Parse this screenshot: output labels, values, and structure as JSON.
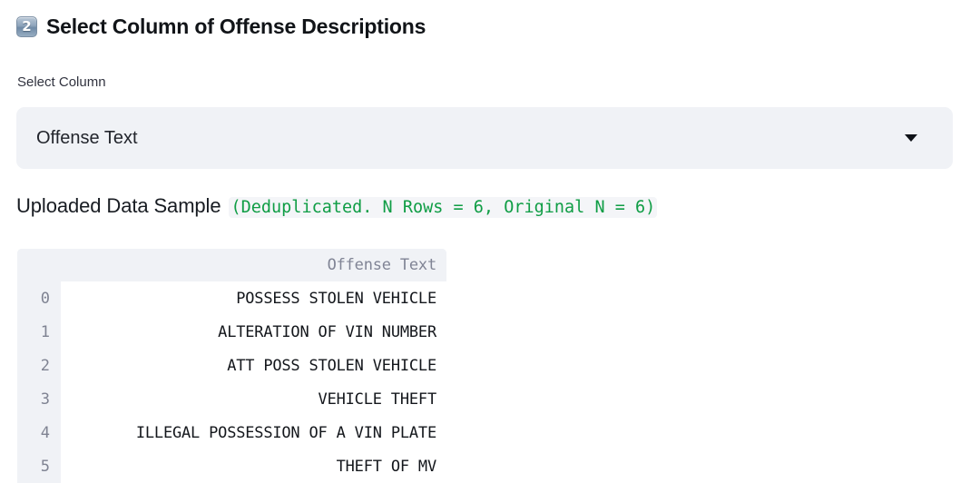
{
  "section": {
    "badge": "2",
    "badge_icon": "keycap-two-icon",
    "title": "Select Column of Offense Descriptions"
  },
  "select_column": {
    "label": "Select Column",
    "selected_value": "Offense Text",
    "caret_icon": "chevron-down-icon"
  },
  "data_sample": {
    "heading": "Uploaded Data Sample",
    "summary": "(Deduplicated. N Rows = 6, Original N = 6)"
  },
  "table": {
    "column_header": "Offense Text",
    "index_header": "",
    "rows": [
      {
        "index": "0",
        "value": "POSSESS STOLEN VEHICLE"
      },
      {
        "index": "1",
        "value": "ALTERATION OF VIN NUMBER"
      },
      {
        "index": "2",
        "value": "ATT POSS STOLEN VEHICLE"
      },
      {
        "index": "3",
        "value": "VEHICLE THEFT"
      },
      {
        "index": "4",
        "value": "ILLEGAL POSSESSION OF A VIN PLATE"
      },
      {
        "index": "5",
        "value": "THEFT OF MV"
      }
    ]
  },
  "colors": {
    "surface_gray": "#f0f2f6",
    "text_primary": "#0e1117",
    "text_muted": "#808495",
    "accent_green": "#0f9d45",
    "white": "#ffffff"
  }
}
